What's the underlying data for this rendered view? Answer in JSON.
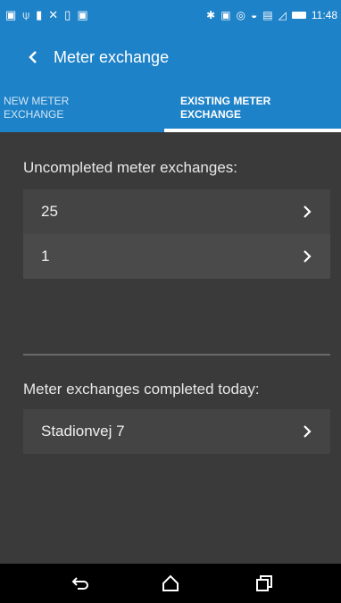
{
  "status_bar": {
    "time": "11:48"
  },
  "app_bar": {
    "title": "Meter exchange"
  },
  "tabs": [
    {
      "label": "NEW METER EXCHANGE",
      "active": false
    },
    {
      "label": "EXISTING METER EXCHANGE",
      "active": true
    }
  ],
  "uncompleted": {
    "heading": "Uncompleted meter exchanges:",
    "items": [
      {
        "label": "25"
      },
      {
        "label": "1"
      }
    ]
  },
  "completed": {
    "heading": "Meter exchanges completed today:",
    "items": [
      {
        "label": "Stadionvej 7"
      }
    ]
  },
  "colors": {
    "primary": "#1e82c8",
    "background": "#3a3a3a",
    "item_bg": "#444444",
    "item_bg_alt": "#4a4a4a"
  },
  "icons": {
    "back": "chevron-left-icon",
    "item": "chevron-right-icon",
    "nav_back": "back-icon",
    "nav_home": "home-icon",
    "nav_recents": "recents-icon"
  }
}
